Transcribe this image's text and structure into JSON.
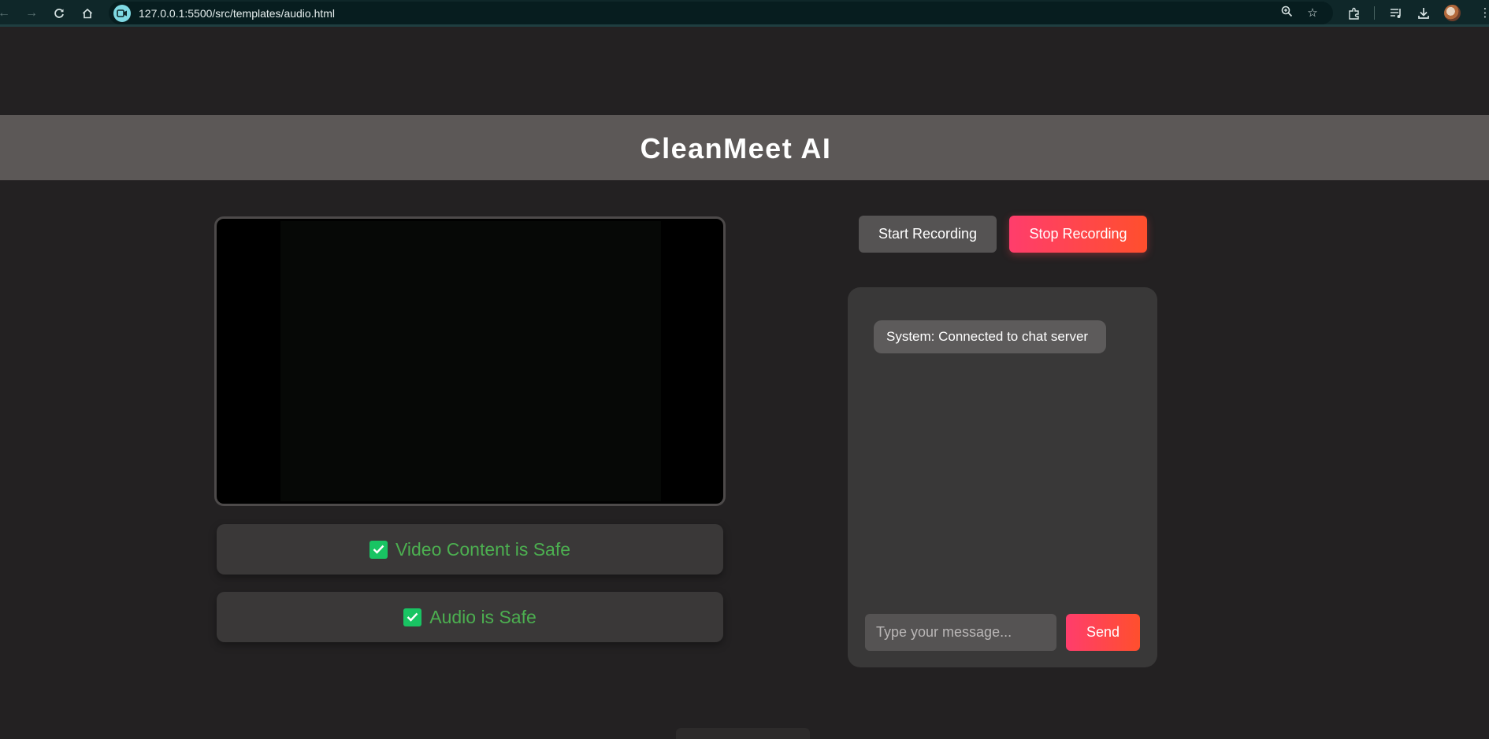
{
  "browser": {
    "url": "127.0.0.1:5500/src/templates/audio.html"
  },
  "app": {
    "title": "CleanMeet AI"
  },
  "video": {
    "status_label": "Video Content is Safe"
  },
  "audio": {
    "status_label": "Audio is Safe"
  },
  "recording": {
    "start_label": "Start Recording",
    "stop_label": "Stop Recording"
  },
  "chat": {
    "messages": [
      {
        "text": "System: Connected to chat server"
      }
    ],
    "input_placeholder": "Type your message...",
    "send_label": "Send"
  },
  "colors": {
    "page_background": "#232122",
    "header_background": "#5c5857",
    "safe_text": "#4caf50",
    "check_green": "#19c463",
    "accent_gradient_start": "#ff3d6c",
    "accent_gradient_end": "#ff4f2d"
  }
}
